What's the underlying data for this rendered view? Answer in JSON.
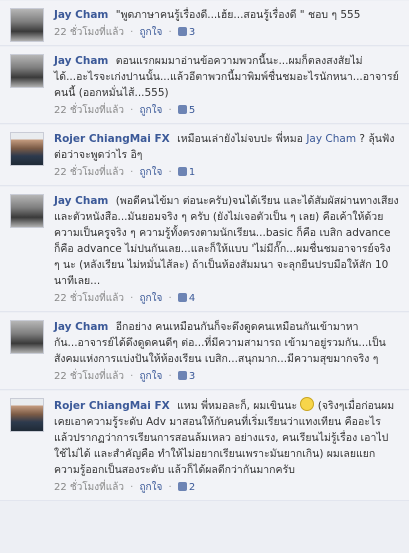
{
  "comments": [
    {
      "author": "Jay Cham",
      "text": "\"พูดภาษาคนรู้เรื่องดี...เฮ้ย...สอนรู้เรื่องดี \" ชอบ ๆ 555",
      "time": "22 ชั่วโมงที่แล้ว",
      "like_label": "ถูกใจ",
      "likes": "3"
    },
    {
      "author": "Jay Cham",
      "text": "ตอนแรกผมมาอ่านข้อความพวกนี้นะ...ผมก็ตลงสงสัยไม่ได้...อะไรจะเก่งปานนั้น...แล้วอีตาพวกนี้มาพิมพ์ชื่นชมอะไรนักหนา...อาจารย์ คนนี้ (ออกหมั่นไส้...555)",
      "time": "22 ชั่วโมงที่แล้ว",
      "like_label": "ถูกใจ",
      "likes": "5"
    },
    {
      "author": "Rojer ChiangMai FX",
      "text": "เหมือนเล่ายังไม่จบปะ พี่หมอ",
      "mention": "Jay Cham",
      "text_after": "? ลุ้นฟังต่อว่าจะพูดว่าไร อิๆ",
      "time": "22 ชั่วโมงที่แล้ว",
      "like_label": "ถูกใจ",
      "likes": "1"
    },
    {
      "author": "Jay Cham",
      "text": "(พอดีคนไข้มา ต่อนะครับ)จนได้เรียน และได้สัมผัสผ่านทางเสียงและตัวหนังสือ...มันยอมจริง ๆ ครับ (ยังไม่เจอตัวเป็น ๆ เลย) คือเค้าให้ด้วยความเป็นครูจริง ๆ ความรู้ทั้งตรงตามนักเรียน...basic ก็คือ เบสิก advance ก็คือ advance ไม่ปนกันเลย...และก็ให้แบบ 'ไม่มีกั๊ก...ผมชื่นชมอาจารย์จริง ๆ นะ (หลังเรียน ไม่หมั่นไส้ละ) ถ้าเป็นห้องสัมมนา จะลุกยืนปรบมือให้สัก 10 นาทีเลย...",
      "time": "22 ชั่วโมงที่แล้ว",
      "like_label": "ถูกใจ",
      "likes": "4"
    },
    {
      "author": "Jay Cham",
      "text": "อีกอย่าง คนเหมือนกันก็จะดึงดูดคนเหมือนกันเข้ามาหา กัน...อาจารย์ได้ดึงดูดคนดีๆ ต่อ...ที่มีความสามารถ เข้ามาอยู่รวมกัน...เป็นสังคมแห่งการแบ่งปันให้ห้องเรียน เบสิก...สนุกมาก...มีความสุขมากจริง ๆ",
      "time": "22 ชั่วโมงที่แล้ว",
      "like_label": "ถูกใจ",
      "likes": "3"
    },
    {
      "author": "Rojer ChiangMai FX",
      "text": "แหม พี่หมอละก็, ผมเขินนะ",
      "text_after": "(จริงๆเมื่อก่อนผมเคยเอาความรู้ระดับ Adv มาสอนให้กับคนที่เริ่มเรียนว่าแทงเทียน คืออะไร แล้วปรากฏว่าการเรียนการสอนล้มเหลว อย่างแรง, คนเรียนไม่รู้เรื่อง เอาไปใช้ไม่ได้ และสำคัญคือ ทำให้ไม่อยากเรียนเพราะมันยากเกิน) ผมเลยแยกความรู้ออกเป็นสองระดับ แล้วก็ได้ผลดีกว่ากันมากครับ",
      "time": "22 ชั่วโมงที่แล้ว",
      "like_label": "ถูกใจ",
      "likes": "2"
    }
  ],
  "separator": "·"
}
